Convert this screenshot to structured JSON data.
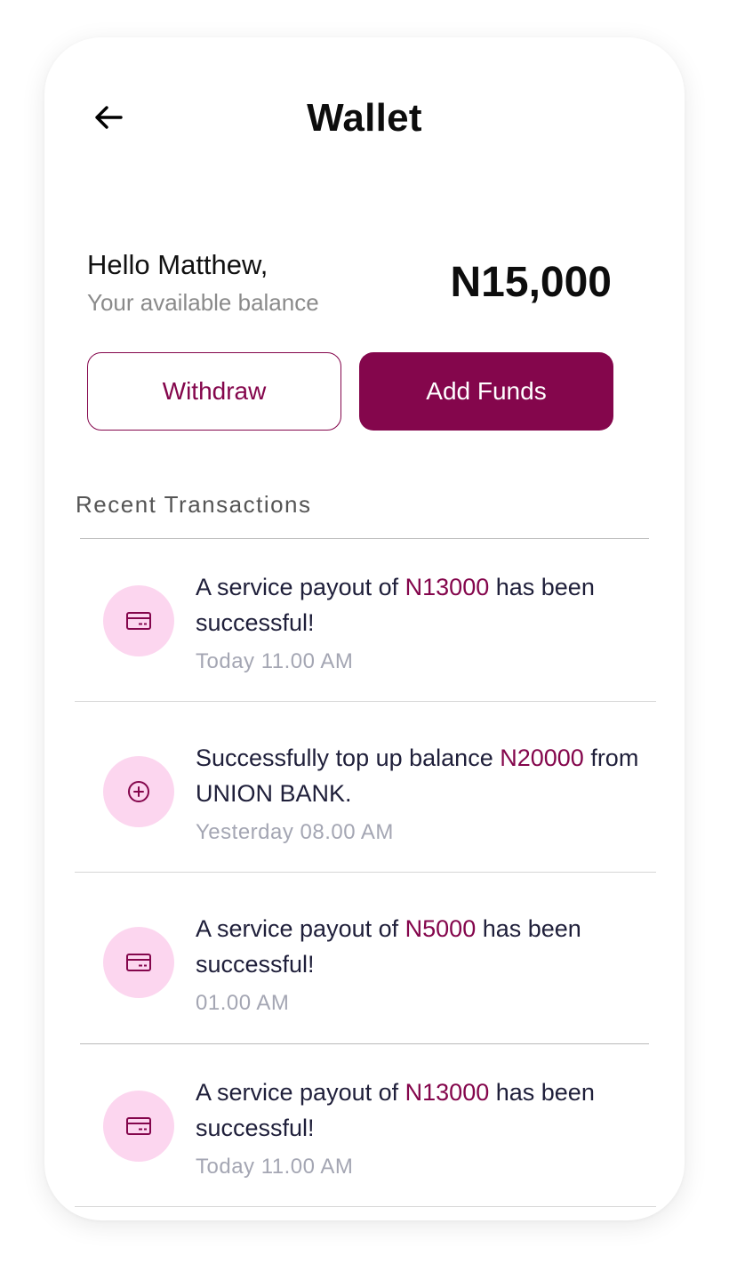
{
  "header": {
    "title": "Wallet",
    "back_icon": "arrow-left-icon"
  },
  "balance": {
    "greeting": "Hello Matthew,",
    "label": "Your available balance",
    "amount": "N15,000"
  },
  "actions": {
    "withdraw_label": "Withdraw",
    "add_funds_label": "Add Funds"
  },
  "transactions": {
    "section_title": "Recent Transactions",
    "items": [
      {
        "icon": "card-icon",
        "text_before": "A service payout of ",
        "amount": "N13000",
        "text_after": " has been successful!",
        "time": "Today 11.00 AM"
      },
      {
        "icon": "plus-circle-icon",
        "text_before": "Successfully top up balance ",
        "amount": "N20000",
        "text_after": " from UNION BANK.",
        "time": "Yesterday 08.00 AM"
      },
      {
        "icon": "card-icon",
        "text_before": "A service payout of ",
        "amount": "N5000",
        "text_after": " has been successful!",
        "time": "01.00 AM"
      },
      {
        "icon": "card-icon",
        "text_before": "A service payout of ",
        "amount": "N13000",
        "text_after": " has been successful!",
        "time": "Today 11.00 AM"
      }
    ]
  },
  "colors": {
    "accent": "#84064c",
    "icon_bg": "#fcd6ef",
    "muted_text": "#a4a6b3"
  }
}
